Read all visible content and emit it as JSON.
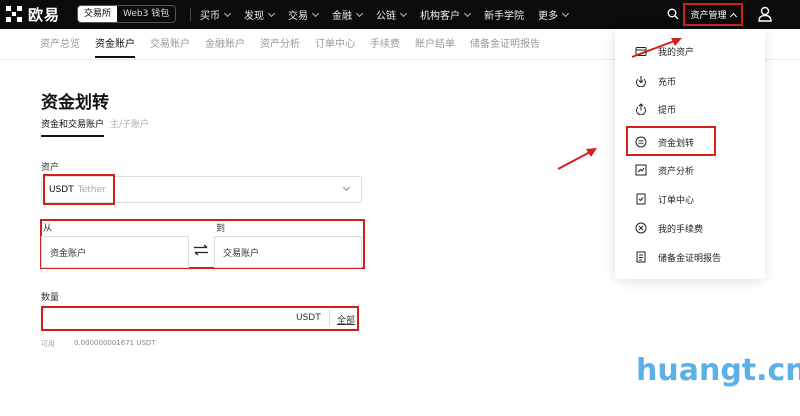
{
  "brand": {
    "name": "欧易"
  },
  "switcher": {
    "exchange": "交易所",
    "wallet": "Web3 钱包"
  },
  "topnav": [
    {
      "label": "买币",
      "has_caret": true
    },
    {
      "label": "发现",
      "has_caret": true
    },
    {
      "label": "交易",
      "has_caret": true
    },
    {
      "label": "金融",
      "has_caret": true
    },
    {
      "label": "公链",
      "has_caret": true
    },
    {
      "label": "机构客户",
      "has_caret": true
    },
    {
      "label": "新手学院",
      "has_caret": false
    },
    {
      "label": "更多",
      "has_caret": true
    }
  ],
  "header_right": {
    "asset_management": "资产管理"
  },
  "subnav": [
    {
      "label": "资产总览",
      "active": false
    },
    {
      "label": "资金账户",
      "active": true
    },
    {
      "label": "交易账户",
      "active": false
    },
    {
      "label": "金融账户",
      "active": false
    },
    {
      "label": "资产分析",
      "active": false
    },
    {
      "label": "订单中心",
      "active": false
    },
    {
      "label": "手续费",
      "active": false
    },
    {
      "label": "账户结单",
      "active": false
    },
    {
      "label": "储备金证明报告",
      "active": false
    }
  ],
  "page": {
    "title": "资金划转",
    "tabs": [
      {
        "label": "资金和交易账户",
        "active": true
      },
      {
        "label": "主/子账户",
        "active": false
      }
    ]
  },
  "form": {
    "asset_label": "资产",
    "asset_symbol": "USDT",
    "asset_name": "Tether",
    "from_label": "从",
    "to_label": "到",
    "from_value": "资金账户",
    "to_value": "交易账户",
    "amount_label": "数量",
    "amount_unit": "USDT",
    "all_label": "全部",
    "available_label": "可用",
    "available_value": "0.000000001671 USDT"
  },
  "dropdown": {
    "items": [
      {
        "label": "我的资产",
        "icon": "wallet-icon"
      },
      {
        "label": "充币",
        "icon": "deposit-icon"
      },
      {
        "label": "提币",
        "icon": "withdraw-icon"
      },
      {
        "label": "资金划转",
        "icon": "transfer-icon"
      },
      {
        "label": "资产分析",
        "icon": "analysis-icon"
      },
      {
        "label": "订单中心",
        "icon": "order-icon"
      },
      {
        "label": "我的手续费",
        "icon": "fee-icon"
      },
      {
        "label": "储备金证明报告",
        "icon": "report-icon"
      }
    ]
  },
  "watermark": "huangt.cn",
  "colors": {
    "highlight": "#d0201c",
    "topbar": "#0b0b0b",
    "watermark": "#5cb0e8"
  }
}
